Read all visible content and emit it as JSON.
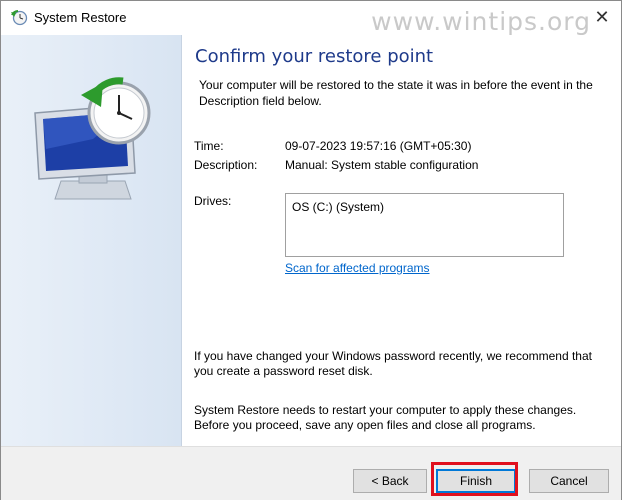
{
  "window": {
    "title": "System Restore",
    "watermark": "www.wintips.org",
    "close_glyph": "✕"
  },
  "icons": {
    "app": "system-restore-icon",
    "hero": "computer-clock-restore-icon",
    "close": "close-icon"
  },
  "colors": {
    "heading": "#1e3a8a",
    "link": "#0066cc",
    "highlight": "#e0101e",
    "default_button_border": "#0078d7"
  },
  "main": {
    "heading": "Confirm your restore point",
    "intro": "Your computer will be restored to the state it was in before the event in the Description field below.",
    "time_label": "Time:",
    "time_value": "09-07-2023 19:57:16 (GMT+05:30)",
    "description_label": "Description:",
    "description_value": "Manual: System stable configuration",
    "drives_label": "Drives:",
    "drives": [
      "OS (C:) (System)"
    ],
    "scan_link": "Scan for affected programs",
    "note_password": "If you have changed your Windows password recently, we recommend that you create a password reset disk.",
    "note_restart": "System Restore needs to restart your computer to apply these changes. Before you proceed, save any open files and close all programs."
  },
  "footer": {
    "back_label": "< Back",
    "finish_label": "Finish",
    "cancel_label": "Cancel"
  }
}
